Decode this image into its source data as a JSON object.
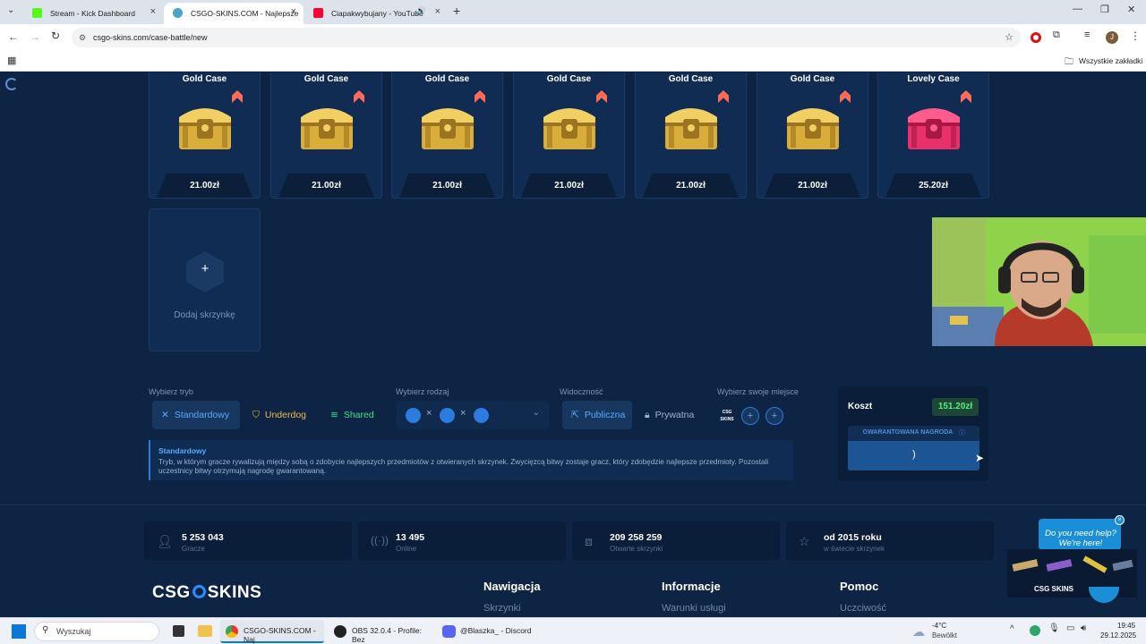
{
  "browser": {
    "tabs": [
      {
        "title": "Stream - Kick Dashboard",
        "color": "#53fc18"
      },
      {
        "title": "CSGO-SKINS.COM - Najlepsze",
        "color": "#4aa3c9"
      },
      {
        "title": "Ciapakwybujany - YouTube",
        "color": "#ff0033"
      }
    ],
    "url": "csgo-skins.com/case-battle/new",
    "bookmarks_label": "Wszystkie zakładki",
    "profile_initial": "J"
  },
  "cases": [
    {
      "name": "Gold Case",
      "price": "21.00zł",
      "type": "gold"
    },
    {
      "name": "Gold Case",
      "price": "21.00zł",
      "type": "gold"
    },
    {
      "name": "Gold Case",
      "price": "21.00zł",
      "type": "gold"
    },
    {
      "name": "Gold Case",
      "price": "21.00zł",
      "type": "gold"
    },
    {
      "name": "Gold Case",
      "price": "21.00zł",
      "type": "gold"
    },
    {
      "name": "Gold Case",
      "price": "21.00zł",
      "type": "gold"
    },
    {
      "name": "Lovely Case",
      "price": "25.20zł",
      "type": "lovely"
    }
  ],
  "add_case": {
    "plus": "+",
    "label": "Dodaj skrzynkę"
  },
  "options": {
    "mode_label": "Wybierz tryb",
    "modes": [
      "Standardowy",
      "Underdog",
      "Shared"
    ],
    "type_label": "Wybierz rodzaj",
    "type_sep": "×",
    "visibility_label": "Widoczność",
    "visibility": [
      "Publiczna",
      "Prywatna"
    ],
    "seat_label": "Wybierz swoje miejsce",
    "seat_logo": "CSG SKINS",
    "seat_plus": "+"
  },
  "info": {
    "title": "Standardowy",
    "text": "Tryb, w którym gracze rywalizują między sobą o zdobycie najlepszych przedmiotów z otwieranych skrzynek. Zwycięzcą bitwy zostaje gracz, który zdobędzie najlepsze przedmioty. Pozostali uczestnicy bitwy otrzymują nagrodę gwarantowaną."
  },
  "cost": {
    "label": "Koszt",
    "value": "151.20zł",
    "guaranteed": "GWARANTOWANA NAGRODA",
    "spinner": ")"
  },
  "stats": [
    {
      "value": "5 253 043",
      "label": "Gracze",
      "icon": "user-icon"
    },
    {
      "value": "13 495",
      "label": "Online",
      "icon": "broadcast-icon"
    },
    {
      "value": "209 258 259",
      "label": "Otwarte skrzynki",
      "icon": "box-icon"
    },
    {
      "value": "od 2015 roku",
      "label": "w świecie skrzynek",
      "icon": "star-icon"
    }
  ],
  "footer": {
    "logo_left": "CSG",
    "logo_right": "SKINS",
    "columns": [
      {
        "title": "Nawigacja",
        "link": "Skrzynki"
      },
      {
        "title": "Informacje",
        "link": "Warunki usługi"
      },
      {
        "title": "Pomoc",
        "link": "Uczciwość"
      }
    ]
  },
  "help": {
    "text": "Do you need help? We're here!",
    "brand": "CSG SKINS"
  },
  "taskbar": {
    "search": "Wyszukaj",
    "apps": [
      "CSGO-SKINS.COM - Naj",
      "OBS 32.0.4 - Profile: Bez",
      "@Blaszka_ - Discord"
    ],
    "weather_temp": "-4°C",
    "weather_desc": "Bewölkt",
    "time": "19:45",
    "date": "29.12.2025"
  }
}
